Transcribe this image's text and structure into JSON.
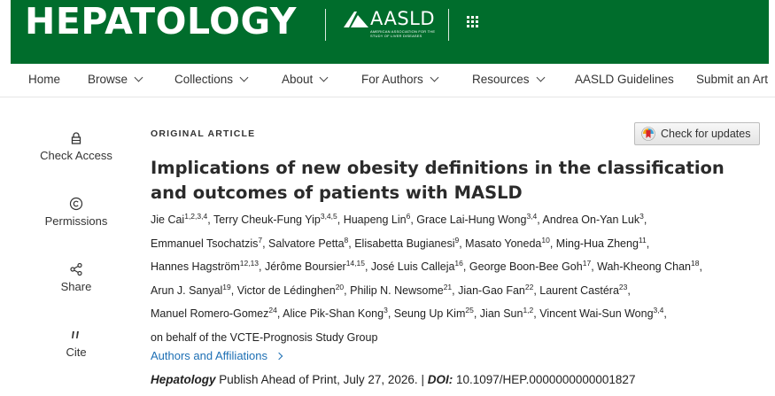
{
  "header": {
    "logo_text": "HEPATOLOGY",
    "aasld_text": "AASLD",
    "aasld_subtext": "AMERICAN ASSOCIATION FOR THE STUDY OF LIVER DISEASES",
    "brand_color": "#006d2c"
  },
  "nav": {
    "items": [
      {
        "label": "Home",
        "dropdown": false
      },
      {
        "label": "Browse",
        "dropdown": true
      },
      {
        "label": "Collections",
        "dropdown": true
      },
      {
        "label": "About",
        "dropdown": true
      },
      {
        "label": "For Authors",
        "dropdown": true
      },
      {
        "label": "Resources",
        "dropdown": true
      },
      {
        "label": "AASLD Guidelines",
        "dropdown": false
      },
      {
        "label": "Submit an Art",
        "dropdown": false
      }
    ]
  },
  "sidebar": {
    "items": [
      {
        "label": "Check Access",
        "icon": "lock-icon"
      },
      {
        "label": "Permissions",
        "icon": "copyright-icon"
      },
      {
        "label": "Share",
        "icon": "share-icon"
      },
      {
        "label": "Cite",
        "icon": "quote-icon"
      }
    ]
  },
  "updates_button": {
    "label": "Check for updates"
  },
  "article": {
    "kicker": "ORIGINAL ARTICLE",
    "title": "Implications of new obesity definitions in the classification and outcomes of patients with MASLD",
    "authors": [
      {
        "name": "Jie Cai",
        "sup": "1,2,3,4"
      },
      {
        "name": "Terry Cheuk-Fung Yip",
        "sup": "3,4,5"
      },
      {
        "name": "Huapeng Lin",
        "sup": "6"
      },
      {
        "name": "Grace Lai-Hung Wong",
        "sup": "3,4"
      },
      {
        "name": "Andrea On-Yan Luk",
        "sup": "3"
      },
      {
        "name": "Emmanuel Tsochatzis",
        "sup": "7"
      },
      {
        "name": "Salvatore Petta",
        "sup": "8"
      },
      {
        "name": "Elisabetta Bugianesi",
        "sup": "9"
      },
      {
        "name": "Masato Yoneda",
        "sup": "10"
      },
      {
        "name": "Ming-Hua Zheng",
        "sup": "11"
      },
      {
        "name": "Hannes Hagström",
        "sup": "12,13"
      },
      {
        "name": "Jérôme Boursier",
        "sup": "14,15"
      },
      {
        "name": "José Luis Calleja",
        "sup": "16"
      },
      {
        "name": "George Boon-Bee Goh",
        "sup": "17"
      },
      {
        "name": "Wah-Kheong Chan",
        "sup": "18"
      },
      {
        "name": "Arun J. Sanyal",
        "sup": "19"
      },
      {
        "name": "Victor de Lédinghen",
        "sup": "20"
      },
      {
        "name": "Philip N. Newsome",
        "sup": "21"
      },
      {
        "name": "Jian-Gao Fan",
        "sup": "22"
      },
      {
        "name": "Laurent Castéra",
        "sup": "23"
      },
      {
        "name": "Manuel Romero-Gomez",
        "sup": "24"
      },
      {
        "name": "Alice Pik-Shan Kong",
        "sup": "3"
      },
      {
        "name": "Seung Up Kim",
        "sup": "25"
      },
      {
        "name": "Jian Sun",
        "sup": "1,2"
      },
      {
        "name": "Vincent Wai-Sun Wong",
        "sup": "3,4"
      }
    ],
    "group": "on behalf of the VCTE-Prognosis Study Group",
    "affiliations_link": "Authors and Affiliations",
    "journal": "Hepatology",
    "pub_text": "Publish Ahead of Print, July 27, 2026.",
    "doi_label": "DOI:",
    "doi": "10.1097/HEP.0000000000001827",
    "link_color": "#1d6fb4"
  }
}
